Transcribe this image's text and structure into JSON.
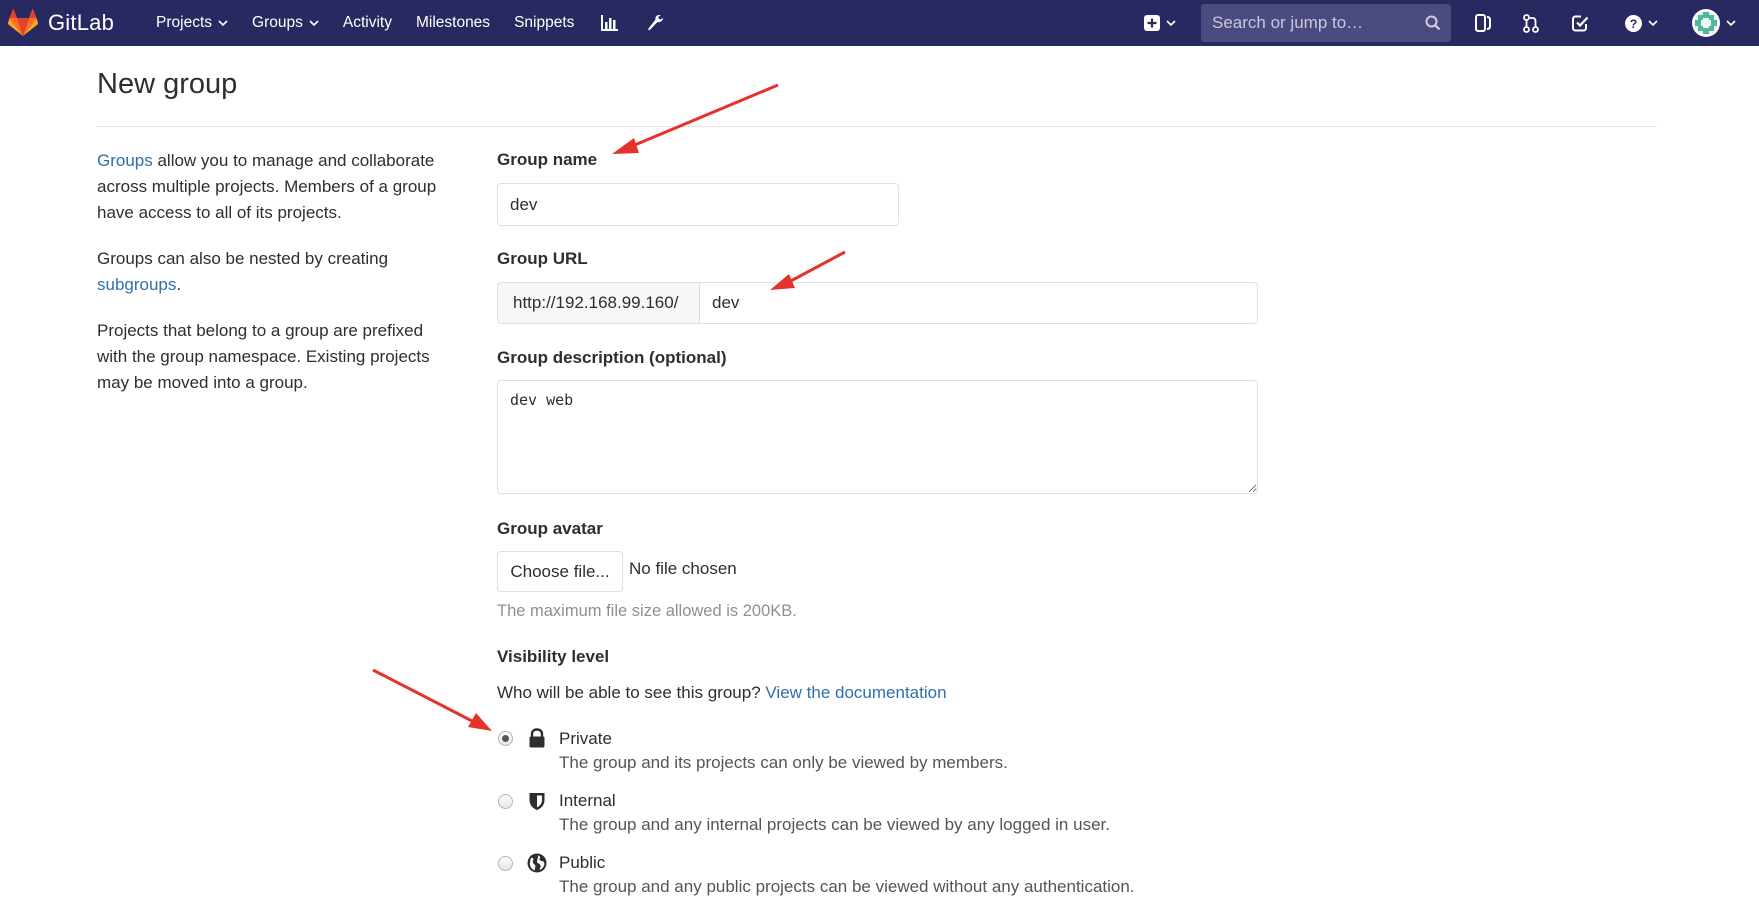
{
  "navbar": {
    "brand": "GitLab",
    "links": [
      {
        "label": "Projects",
        "has_dropdown": true
      },
      {
        "label": "Groups",
        "has_dropdown": true
      },
      {
        "label": "Activity",
        "has_dropdown": false
      },
      {
        "label": "Milestones",
        "has_dropdown": false
      },
      {
        "label": "Snippets",
        "has_dropdown": false
      }
    ],
    "icons": [
      "chart-icon",
      "wrench-icon",
      "plus-square-icon",
      "issues-icon",
      "merge-request-icon",
      "todo-check-icon",
      "help-icon",
      "user-avatar"
    ],
    "search_placeholder": "Search or jump to…",
    "colors": {
      "navbar_bg": "#292961",
      "search_bg": "#4b4b80",
      "logo_orange": "#e24329"
    }
  },
  "page": {
    "title": "New group",
    "sidebar": {
      "p1_link": "Groups",
      "p1_text": " allow you to manage and collaborate across multiple projects. Members of a group have access to all of its projects.",
      "p2_text": "Groups can also be nested by creating ",
      "p2_link": "subgroups",
      "p2_end": ".",
      "p3_text": "Projects that belong to a group are prefixed with the group namespace. Existing projects may be moved into a group."
    }
  },
  "form": {
    "group_name": {
      "label": "Group name",
      "value": "dev"
    },
    "group_url": {
      "label": "Group URL",
      "prefix": "http://192.168.99.160/",
      "value": "dev"
    },
    "description": {
      "label": "Group description (optional)",
      "value": "dev web"
    },
    "avatar": {
      "label": "Group avatar",
      "button": "Choose file...",
      "status": "No file chosen",
      "help": "The maximum file size allowed is 200KB."
    },
    "visibility": {
      "label": "Visibility level",
      "question": "Who will be able to see this group?",
      "doc_link": "View the documentation",
      "selected": "Private",
      "options": [
        {
          "title": "Private",
          "description": "The group and its projects can only be viewed by members.",
          "icon": "lock-icon"
        },
        {
          "title": "Internal",
          "description": "The group and any internal projects can be viewed by any logged in user.",
          "icon": "shield-icon"
        },
        {
          "title": "Public",
          "description": "The group and any public projects can be viewed without any authentication.",
          "icon": "globe-icon"
        }
      ]
    }
  },
  "annotations": {
    "arrow_color": "#e5322d"
  },
  "colors": {
    "link": "#2f6fae",
    "text": "#2e2e2e",
    "muted": "#8f8f8f"
  }
}
